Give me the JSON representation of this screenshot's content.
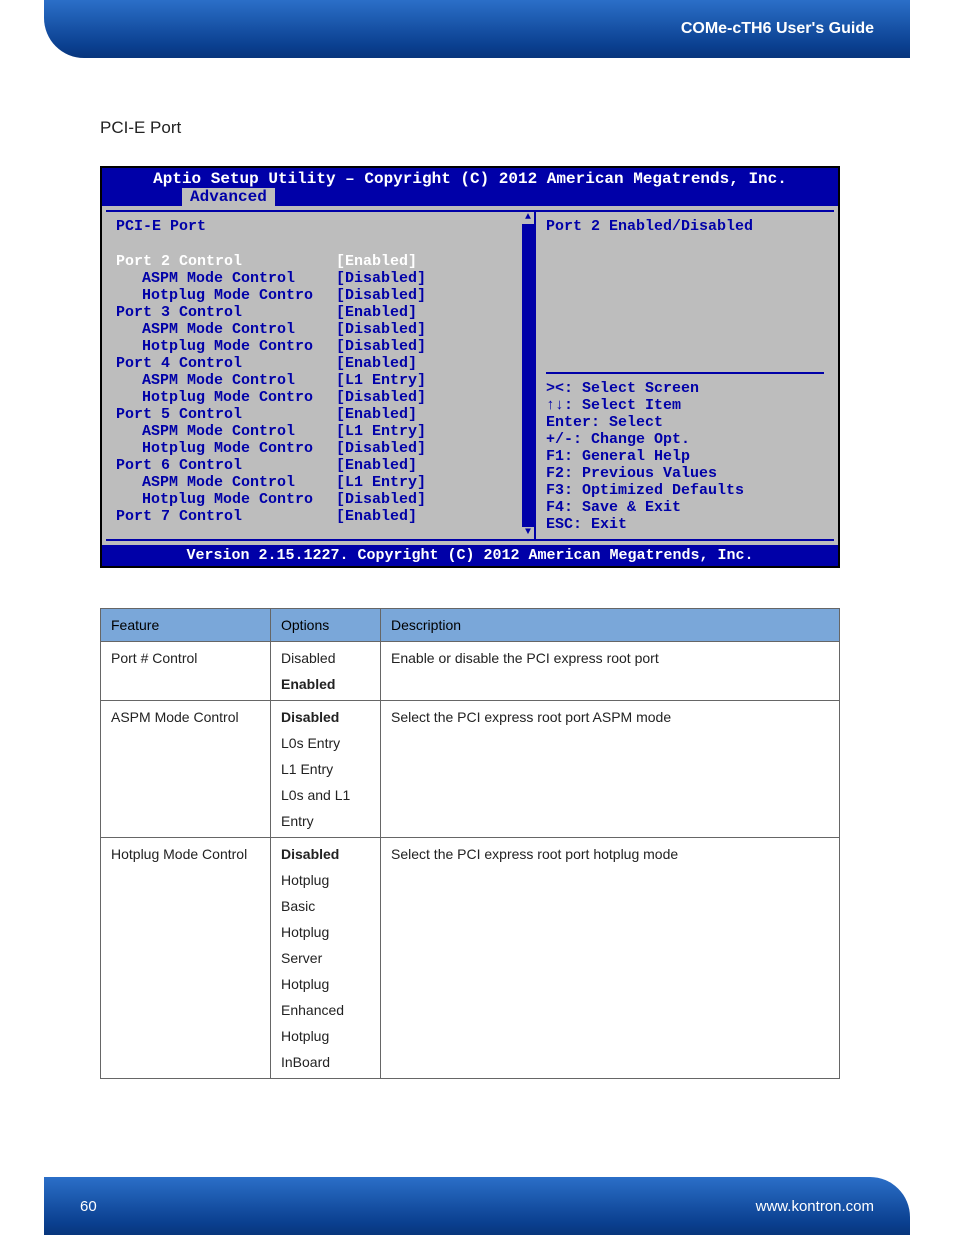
{
  "header": {
    "guide_title": "COMe-cTH6 User's Guide"
  },
  "section": {
    "title": "PCI-E Port"
  },
  "bios": {
    "title": "Aptio Setup Utility – Copyright (C) 2012 American Megatrends, Inc.",
    "tab": "Advanced",
    "page_heading": "PCI-E Port",
    "help_text": "Port 2 Enabled/Disabled",
    "rows": [
      {
        "label": "Port 2 Control",
        "value": "[Enabled]",
        "child": false,
        "selected": true
      },
      {
        "label": "ASPM Mode Control",
        "value": "[Disabled]",
        "child": true,
        "selected": false
      },
      {
        "label": "Hotplug Mode Contro",
        "value": "[Disabled]",
        "child": true,
        "selected": false
      },
      {
        "label": "Port 3 Control",
        "value": "[Enabled]",
        "child": false,
        "selected": false
      },
      {
        "label": "ASPM Mode Control",
        "value": "[Disabled]",
        "child": true,
        "selected": false
      },
      {
        "label": "Hotplug Mode Contro",
        "value": "[Disabled]",
        "child": true,
        "selected": false
      },
      {
        "label": "Port 4 Control",
        "value": "[Enabled]",
        "child": false,
        "selected": false
      },
      {
        "label": "ASPM Mode Control",
        "value": "[L1 Entry]",
        "child": true,
        "selected": false
      },
      {
        "label": "Hotplug Mode Contro",
        "value": "[Disabled]",
        "child": true,
        "selected": false
      },
      {
        "label": "Port 5 Control",
        "value": "[Enabled]",
        "child": false,
        "selected": false
      },
      {
        "label": "ASPM Mode Control",
        "value": "[L1 Entry]",
        "child": true,
        "selected": false
      },
      {
        "label": "Hotplug Mode Contro",
        "value": "[Disabled]",
        "child": true,
        "selected": false
      },
      {
        "label": "Port 6 Control",
        "value": "[Enabled]",
        "child": false,
        "selected": false
      },
      {
        "label": "ASPM Mode Control",
        "value": "[L1 Entry]",
        "child": true,
        "selected": false
      },
      {
        "label": "Hotplug Mode Contro",
        "value": "[Disabled]",
        "child": true,
        "selected": false
      },
      {
        "label": "Port 7 Control",
        "value": "[Enabled]",
        "child": false,
        "selected": false
      }
    ],
    "keyhelp": [
      "><: Select Screen",
      "↑↓: Select Item",
      "Enter: Select",
      "+/-: Change Opt.",
      "F1: General Help",
      "F2: Previous Values",
      "F3: Optimized Defaults",
      "F4: Save & Exit",
      "ESC: Exit"
    ],
    "footer": "Version 2.15.1227. Copyright (C) 2012 American Megatrends, Inc."
  },
  "table": {
    "headers": {
      "feature": "Feature",
      "options": "Options",
      "description": "Description"
    },
    "rows": [
      {
        "feature": "Port # Control",
        "options": [
          {
            "text": "Disabled",
            "bold": false
          },
          {
            "text": "Enabled",
            "bold": true
          }
        ],
        "description": "Enable or disable the PCI express root port"
      },
      {
        "feature": "ASPM Mode Control",
        "options": [
          {
            "text": "Disabled",
            "bold": true
          },
          {
            "text": "L0s Entry",
            "bold": false
          },
          {
            "text": "L1 Entry",
            "bold": false
          },
          {
            "text": "L0s and L1",
            "bold": false
          },
          {
            "text": "Entry",
            "bold": false
          }
        ],
        "description": "Select the PCI express root port ASPM mode"
      },
      {
        "feature": "Hotplug Mode Control",
        "options": [
          {
            "text": "Disabled",
            "bold": true
          },
          {
            "text": "Hotplug",
            "bold": false
          },
          {
            "text": "Basic",
            "bold": false
          },
          {
            "text": "Hotplug",
            "bold": false
          },
          {
            "text": "Server",
            "bold": false
          },
          {
            "text": "Hotplug",
            "bold": false
          },
          {
            "text": "Enhanced",
            "bold": false
          },
          {
            "text": "Hotplug",
            "bold": false
          },
          {
            "text": "InBoard",
            "bold": false
          }
        ],
        "description": "Select the PCI express root port hotplug mode"
      }
    ]
  },
  "footer": {
    "page_number": "60",
    "url": "www.kontron.com"
  }
}
